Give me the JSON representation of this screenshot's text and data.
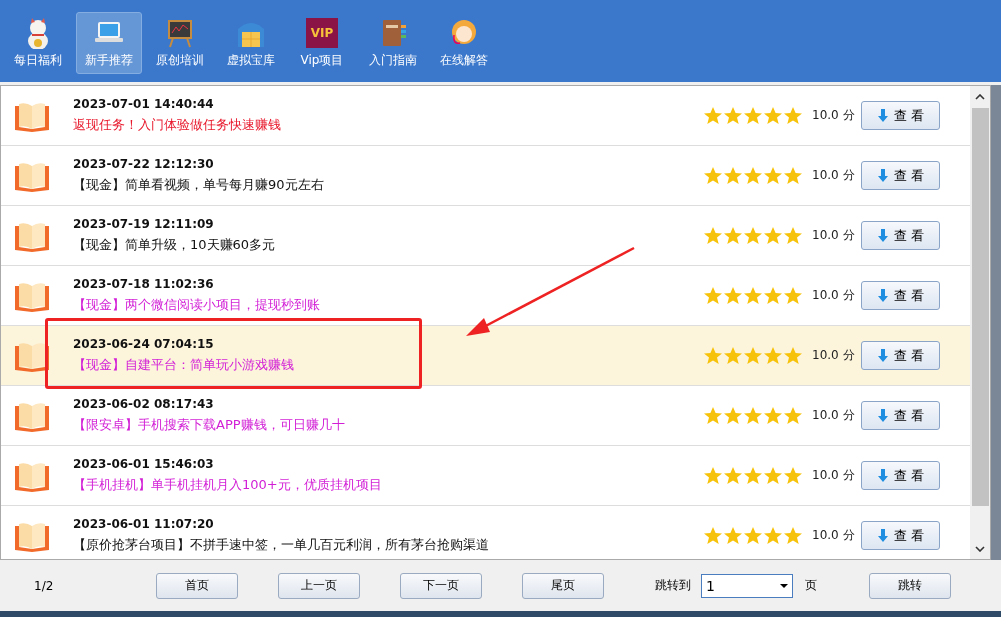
{
  "toolbar": {
    "items": [
      {
        "label": "每日福利",
        "selected": false
      },
      {
        "label": "新手推荐",
        "selected": true
      },
      {
        "label": "原创培训",
        "selected": false
      },
      {
        "label": "虚拟宝库",
        "selected": false
      },
      {
        "label": "Vip项目",
        "selected": false,
        "icon_text": "VIP"
      },
      {
        "label": "入门指南",
        "selected": false
      },
      {
        "label": "在线解答",
        "selected": false
      }
    ]
  },
  "list": {
    "rows": [
      {
        "date": "2023-07-01 14:40:44",
        "title": "返现任务！入门体验做任务快速赚钱",
        "color": "#e8182c",
        "stars": 5,
        "score": "10.0 分",
        "button": "查 看",
        "selected": false,
        "highlighted": false
      },
      {
        "date": "2023-07-22 12:12:30",
        "title": "【现金】简单看视频，单号每月赚90元左右",
        "color": "#111111",
        "stars": 5,
        "score": "10.0 分",
        "button": "查 看",
        "selected": false,
        "highlighted": false
      },
      {
        "date": "2023-07-19 12:11:09",
        "title": "【现金】简单升级，10天赚60多元",
        "color": "#111111",
        "stars": 5,
        "score": "10.0 分",
        "button": "查 看",
        "selected": false,
        "highlighted": false
      },
      {
        "date": "2023-07-18 11:02:36",
        "title": "【现金】两个微信阅读小项目，提现秒到账",
        "color": "#d21fd6",
        "stars": 5,
        "score": "10.0 分",
        "button": "查 看",
        "selected": false,
        "highlighted": false
      },
      {
        "date": "2023-06-24 07:04:15",
        "title": "【现金】自建平台：简单玩小游戏赚钱",
        "color": "#d21fd6",
        "stars": 5,
        "score": "10.0 分",
        "button": "查 看",
        "selected": true,
        "highlighted": true
      },
      {
        "date": "2023-06-02 08:17:43",
        "title": "【限安卓】手机搜索下载APP赚钱，可日赚几十",
        "color": "#d21fd6",
        "stars": 5,
        "score": "10.0 分",
        "button": "查 看",
        "selected": false,
        "highlighted": false
      },
      {
        "date": "2023-06-01 15:46:03",
        "title": "【手机挂机】单手机挂机月入100+元，优质挂机项目",
        "color": "#d21fd6",
        "stars": 5,
        "score": "10.0 分",
        "button": "查 看",
        "selected": false,
        "highlighted": false
      },
      {
        "date": "2023-06-01 11:07:20",
        "title": "【原价抢茅台项目】不拼手速中签，一单几百元利润，所有茅台抢购渠道",
        "color": "#111111",
        "stars": 5,
        "score": "10.0 分",
        "button": "查 看",
        "selected": false,
        "highlighted": false
      }
    ]
  },
  "pagination": {
    "page_info": "1/2",
    "buttons": [
      "首页",
      "上一页",
      "下一页",
      "尾页"
    ],
    "jump_label": "跳转到",
    "page_select": {
      "value": "1"
    },
    "page_unit": "页",
    "go_button": "跳转"
  }
}
